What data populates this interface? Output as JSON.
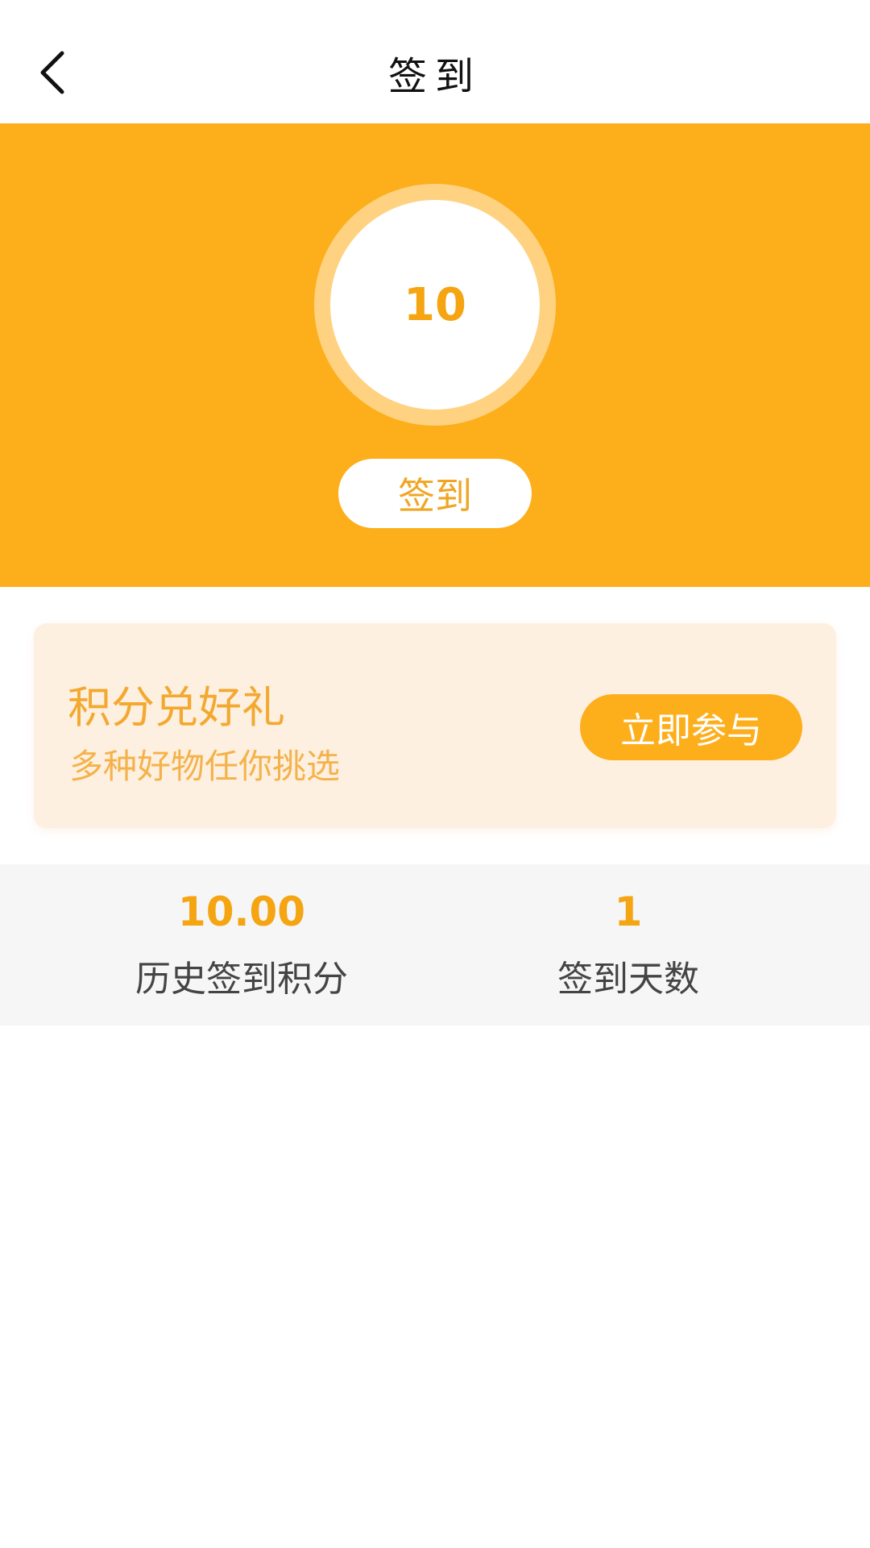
{
  "nav": {
    "title": "签到",
    "back_icon": "chevron-left-icon"
  },
  "hero": {
    "points": "10",
    "checkin_label": "签到"
  },
  "promo": {
    "title": "积分兑好礼",
    "subtitle": "多种好物任你挑选",
    "join_label": "立即参与"
  },
  "stats": {
    "history_points_value": "10.00",
    "history_points_label": "历史签到积分",
    "checkin_days_value": "1",
    "checkin_days_label": "签到天数"
  },
  "colors": {
    "accent": "#fdae1b",
    "accent_text": "#f5a412",
    "promo_bg": "#fdf0e1",
    "stats_bg": "#f6f6f6"
  }
}
